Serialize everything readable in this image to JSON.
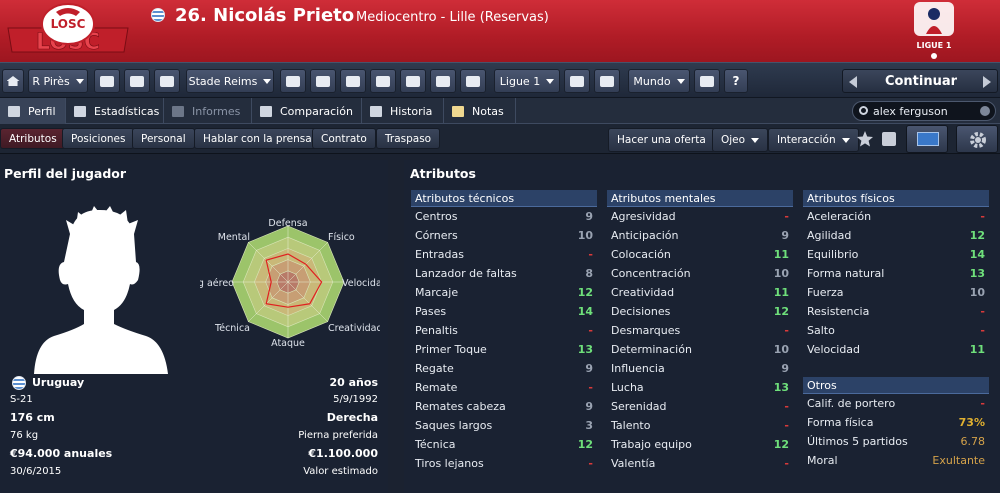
{
  "header": {
    "title": "26. Nicolás Prieto",
    "subtitle": "Mediocentro - Lille (Reservas)",
    "club_logo_text": "LOSC",
    "league_logo_text": "LIGUE 1"
  },
  "toolbar": {
    "manager": "R Pirès",
    "club": "Stade Reims",
    "league": "Ligue 1",
    "world": "Mundo",
    "continue": "Continuar"
  },
  "tabs": {
    "perfil": "Perfil",
    "estadisticas": "Estadísticas",
    "informes": "Informes",
    "comparacion": "Comparación",
    "historia": "Historia",
    "notas": "Notas"
  },
  "search": {
    "value": "alex ferguson"
  },
  "subnav": {
    "atributos": "Atributos",
    "posiciones": "Posiciones",
    "personal": "Personal",
    "prensa": "Hablar con la prensa",
    "contrato": "Contrato",
    "traspaso": "Traspaso",
    "oferta": "Hacer una oferta",
    "ojeo": "Ojeo",
    "interaccion": "Interacción"
  },
  "profile": {
    "title": "Perfil del jugador",
    "nation": "Uruguay",
    "nation_level": "S-21",
    "age": "20 años",
    "birth": "5/9/1992",
    "height": "176 cm",
    "foot": "Derecha",
    "weight": "76 kg",
    "foot_label": "Pierna preferida",
    "wage": "€94.000 anuales",
    "value": "€1.100.000",
    "contract_end": "30/6/2015",
    "value_label": "Valor estimado",
    "radar_labels": {
      "defensa": "Defensa",
      "fisico": "Físico",
      "velocidad": "Velocidad",
      "creatividad": "Creatividad",
      "ataque": "Ataque",
      "tecnica": "Técnica",
      "aereo": "Jg aéreo",
      "mental": "Mental"
    },
    "radar_values": [
      0.5,
      0.45,
      0.6,
      0.55,
      0.45,
      0.55,
      0.3,
      0.55
    ]
  },
  "attributes": {
    "title": "Atributos",
    "technical": {
      "header": "Atributos técnicos",
      "rows": [
        [
          "Centros",
          "9"
        ],
        [
          "Córners",
          "10"
        ],
        [
          "Entradas",
          "-"
        ],
        [
          "Lanzador de faltas",
          "8"
        ],
        [
          "Marcaje",
          "12"
        ],
        [
          "Pases",
          "14"
        ],
        [
          "Penaltis",
          "-"
        ],
        [
          "Primer Toque",
          "13"
        ],
        [
          "Regate",
          "9"
        ],
        [
          "Remate",
          "-"
        ],
        [
          "Remates cabeza",
          "9"
        ],
        [
          "Saques largos",
          "3"
        ],
        [
          "Técnica",
          "12"
        ],
        [
          "Tiros lejanos",
          "-"
        ]
      ]
    },
    "mental": {
      "header": "Atributos mentales",
      "rows": [
        [
          "Agresividad",
          "-"
        ],
        [
          "Anticipación",
          "9"
        ],
        [
          "Colocación",
          "11"
        ],
        [
          "Concentración",
          "10"
        ],
        [
          "Creatividad",
          "11"
        ],
        [
          "Decisiones",
          "12"
        ],
        [
          "Desmarques",
          "-"
        ],
        [
          "Determinación",
          "10"
        ],
        [
          "Influencia",
          "9"
        ],
        [
          "Lucha",
          "13"
        ],
        [
          "Serenidad",
          "-"
        ],
        [
          "Talento",
          "-"
        ],
        [
          "Trabajo equipo",
          "12"
        ],
        [
          "Valentía",
          "-"
        ]
      ]
    },
    "physical": {
      "header": "Atributos físicos",
      "rows": [
        [
          "Aceleración",
          "-"
        ],
        [
          "Agilidad",
          "12"
        ],
        [
          "Equilibrio",
          "14"
        ],
        [
          "Forma natural",
          "13"
        ],
        [
          "Fuerza",
          "10"
        ],
        [
          "Resistencia",
          "-"
        ],
        [
          "Salto",
          "-"
        ],
        [
          "Velocidad",
          "11"
        ]
      ]
    },
    "other": {
      "header": "Otros",
      "rows": [
        [
          "Calif. de portero",
          "-"
        ],
        [
          "Forma física",
          "73%"
        ],
        [
          "Últimos 5 partidos",
          "6.78"
        ],
        [
          "Moral",
          "Exultante"
        ]
      ]
    }
  }
}
